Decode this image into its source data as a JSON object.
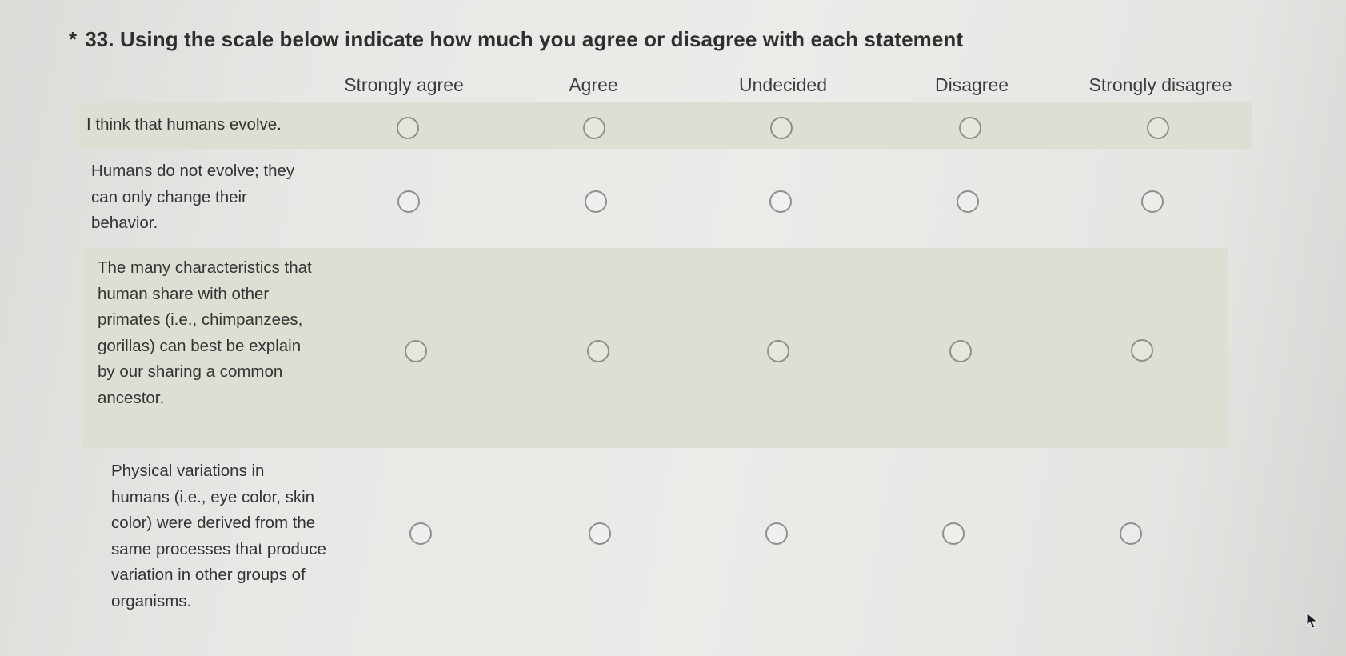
{
  "question": {
    "required_marker": "*",
    "title": "33. Using the scale below indicate how much you agree or disagree with each statement"
  },
  "scale": [
    "Strongly agree",
    "Agree",
    "Undecided",
    "Disagree",
    "Strongly disagree"
  ],
  "statements": [
    {
      "label": "I think that humans evolve."
    },
    {
      "label": "Humans do not evolve; they can only change their behavior."
    },
    {
      "label": "The many characteristics that human share with other primates (i.e., chimpanzees, gorillas) can best be explain by our sharing a common ancestor."
    },
    {
      "label": "Physical variations in humans (i.e., eye color, skin color) were derived from the same processes that produce variation in other groups of organisms."
    }
  ]
}
